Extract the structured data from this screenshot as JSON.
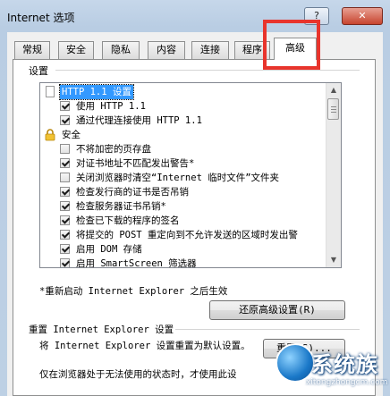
{
  "window": {
    "title": "Internet 选项",
    "help_label": "?",
    "close_label": "✕"
  },
  "tabs": [
    {
      "label": "常规"
    },
    {
      "label": "安全"
    },
    {
      "label": "隐私"
    },
    {
      "label": "内容"
    },
    {
      "label": "连接"
    },
    {
      "label": "程序"
    },
    {
      "label": "高级",
      "active": true
    }
  ],
  "settings": {
    "group_label": "设置",
    "rows": [
      {
        "type": "heading",
        "text": "HTTP 1.1 设置",
        "icon": "document-icon"
      },
      {
        "type": "checkbox",
        "text": "使用 HTTP 1.1",
        "checked": true
      },
      {
        "type": "checkbox",
        "text": "通过代理连接使用 HTTP 1.1",
        "checked": true
      },
      {
        "type": "category",
        "text": "安全",
        "icon": "lock-icon"
      },
      {
        "type": "checkbox",
        "text": "不将加密的页存盘",
        "checked": false
      },
      {
        "type": "checkbox",
        "text": "对证书地址不匹配发出警告*",
        "checked": true
      },
      {
        "type": "checkbox",
        "text": "关闭浏览器时清空“Internet 临时文件”文件夹",
        "checked": false
      },
      {
        "type": "checkbox",
        "text": "检查发行商的证书是否吊销",
        "checked": true
      },
      {
        "type": "checkbox",
        "text": "检查服务器证书吊销*",
        "checked": true
      },
      {
        "type": "checkbox",
        "text": "检查已下载的程序的签名",
        "checked": true
      },
      {
        "type": "checkbox",
        "text": "将提交的 POST 重定向到不允许发送的区域时发出警",
        "checked": true
      },
      {
        "type": "checkbox",
        "text": "启用 DOM 存储",
        "checked": true
      },
      {
        "type": "checkbox",
        "text": "启用 SmartScreen 筛选器",
        "checked": true
      }
    ],
    "restart_note": "*重新启动 Internet Explorer 之后生效",
    "restore_button": "还原高级设置(R)"
  },
  "reset": {
    "group_label": "重置 Internet Explorer 设置",
    "description": "将 Internet Explorer 设置重置为默认设置。",
    "button": "重置(S)...",
    "warning": "仅在浏览器处于无法使用的状态时，才使用此设"
  },
  "watermark": {
    "brand": "系统族",
    "url": "xitongzhongcm.com"
  },
  "colors": {
    "highlight": "#e8342c",
    "selection": "#3399ff"
  }
}
